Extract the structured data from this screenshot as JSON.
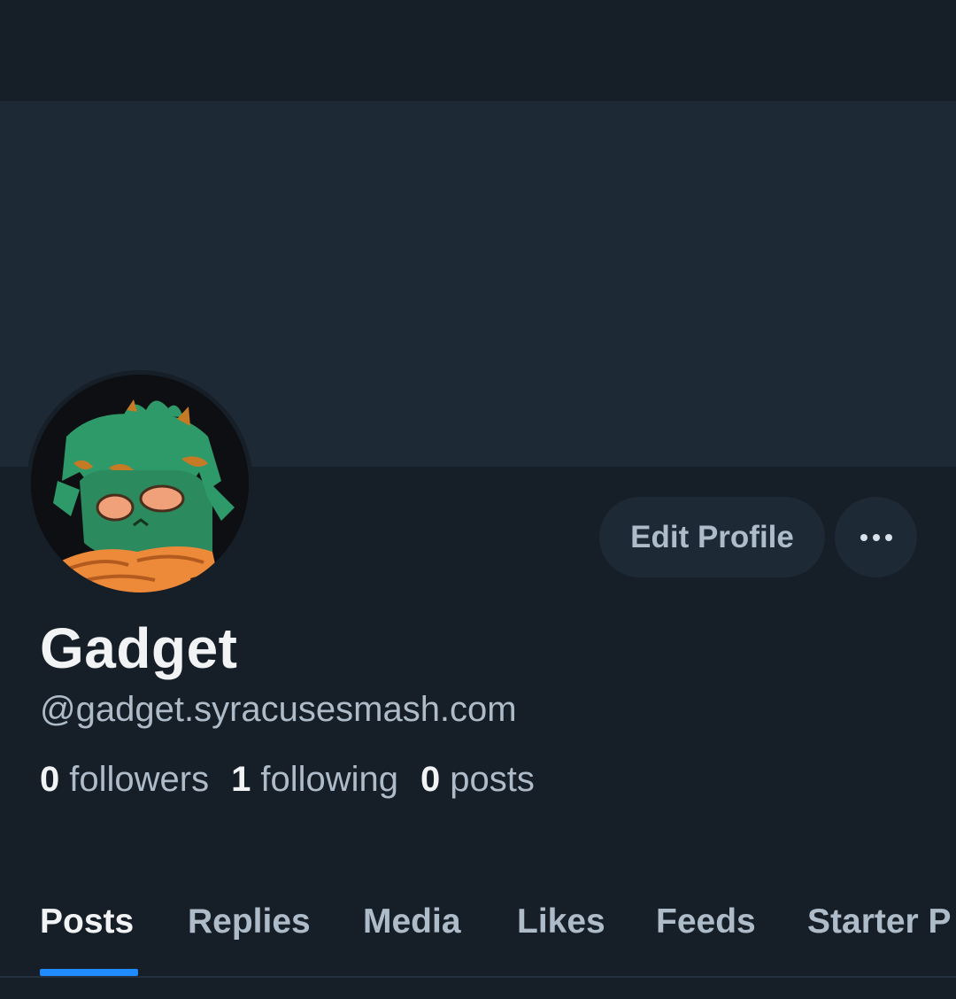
{
  "profile": {
    "display_name": "Gadget",
    "handle": "@gadget.syracusesmash.com",
    "edit_label": "Edit Profile",
    "more_icon": "more-horizontal-icon"
  },
  "stats": {
    "followers_count": "0",
    "followers_label": "followers",
    "following_count": "1",
    "following_label": "following",
    "posts_count": "0",
    "posts_label": "posts"
  },
  "tabs": [
    {
      "label": "Posts",
      "active": true
    },
    {
      "label": "Replies"
    },
    {
      "label": "Media"
    },
    {
      "label": "Likes"
    },
    {
      "label": "Feeds"
    },
    {
      "label": "Starter P"
    }
  ],
  "colors": {
    "background": "#161e27",
    "banner": "#1e2936",
    "accent": "#208bfe",
    "text_primary": "#f1f3f5",
    "text_secondary": "#aebbc9"
  }
}
